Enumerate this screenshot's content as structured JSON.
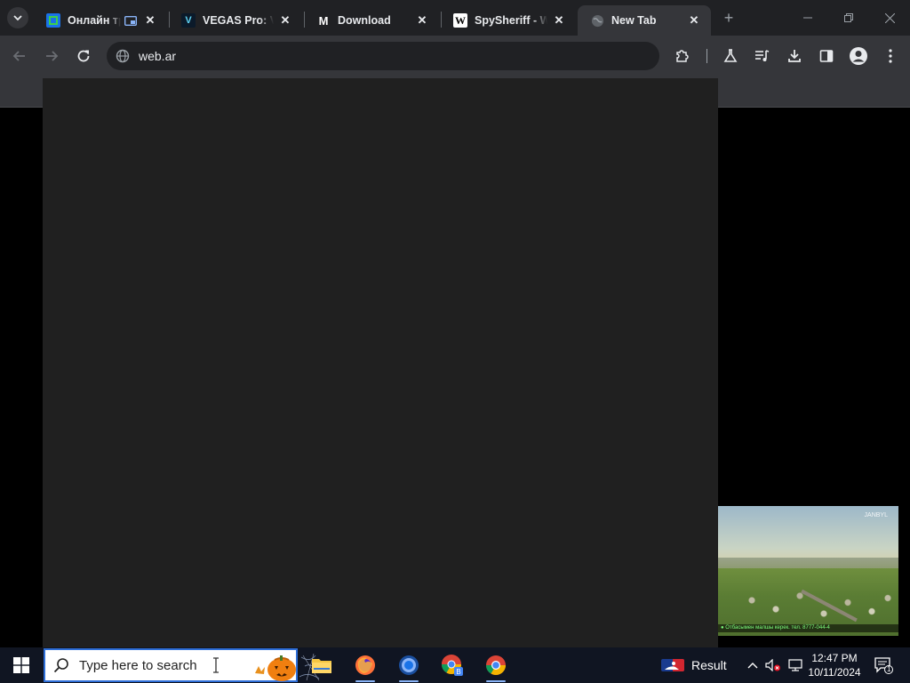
{
  "browser": {
    "tabs": [
      {
        "title": "Онлайн трансляция",
        "favicon_color": "#1a73e8",
        "active": false
      },
      {
        "title": "VEGAS Pro: Video Editing",
        "favicon_letter": "V",
        "active": false
      },
      {
        "title": "Download",
        "favicon_letter": "M",
        "active": false
      },
      {
        "title": "SpySheriff - Wikipedia",
        "favicon_letter": "W",
        "active": false
      },
      {
        "title": "New Tab",
        "active": true
      }
    ],
    "omnibox": {
      "url": "web.ar"
    },
    "colors": {
      "tabstrip_bg": "#202124",
      "toolbar_bg": "#35363a",
      "content_bg": "#202020"
    }
  },
  "video": {
    "channel_logo": "JANBYL",
    "ticker": "● Отбасымен малшы керек. тел. 8777-044-4"
  },
  "taskbar": {
    "search_placeholder": "Type here to search",
    "apps": [
      "file-explorer",
      "firefox",
      "chrome-dev",
      "chrome-b",
      "chrome"
    ],
    "tray": {
      "result_label": "Result"
    },
    "clock": {
      "time": "12:47 PM",
      "date": "10/11/2024"
    },
    "notifications": {
      "count": "1"
    }
  }
}
